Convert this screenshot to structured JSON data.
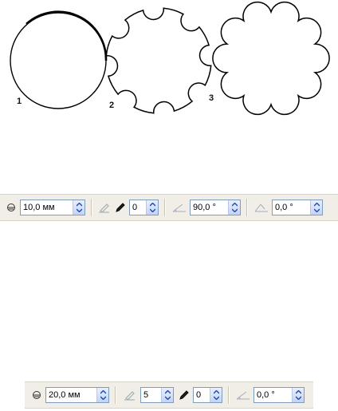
{
  "figure": {
    "labels": [
      "1",
      "2",
      "3"
    ]
  },
  "toolbar1": {
    "size_value": "10,0 мм",
    "outline_value": "0",
    "angle1_value": "90,0 °",
    "angle2_value": "0,0 °"
  },
  "toolbar2": {
    "size_value": "20,0 мм",
    "count_value": "5",
    "outline_value": "0",
    "angle_value": "0,0 °"
  },
  "icons": {
    "size": "radius-icon",
    "pen": "pen-icon",
    "pencil": "pencil-icon",
    "angle": "angle-icon"
  },
  "colors": {
    "toolbar_bg": "#f0eee6",
    "spin_border": "#7f9db9",
    "arrow": "#1d4aa7"
  }
}
